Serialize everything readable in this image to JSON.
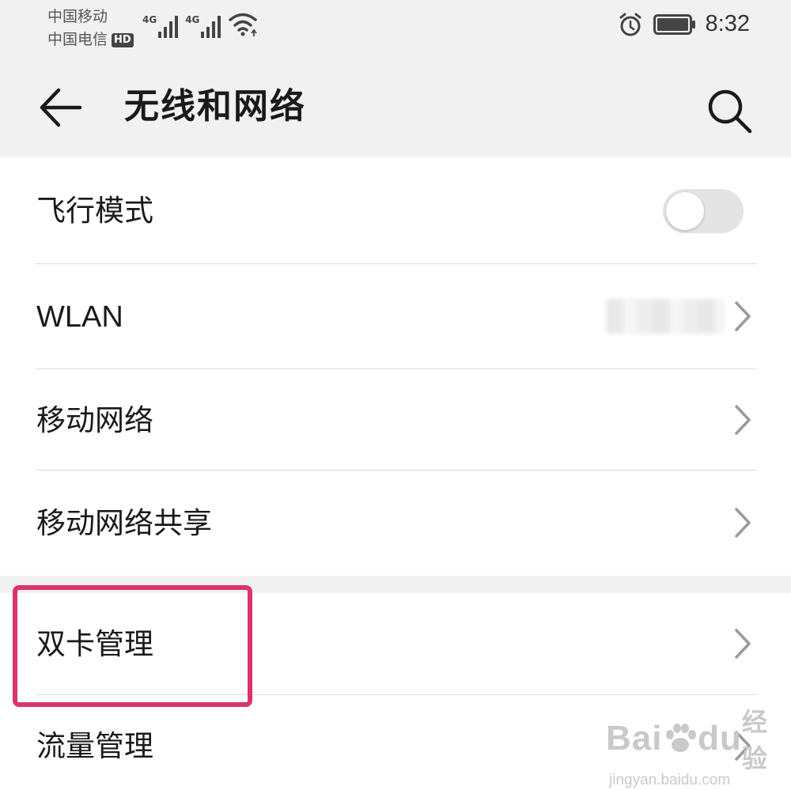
{
  "status_bar": {
    "carrier_1": "中国移动",
    "carrier_2": "中国电信",
    "hd_badge": "HD",
    "net_type_1": "4G",
    "net_type_2": "4G",
    "time": "8:32"
  },
  "app_bar": {
    "title": "无线和网络",
    "back_icon": "arrow-left-icon",
    "search_icon": "search-icon"
  },
  "settings": {
    "airplane_mode": {
      "label": "飞行模式",
      "toggle_on": false
    },
    "wlan": {
      "label": "WLAN"
    },
    "mobile_network": {
      "label": "移动网络"
    },
    "tethering": {
      "label": "移动网络共享"
    },
    "dual_sim": {
      "label": "双卡管理"
    },
    "data_usage": {
      "label": "流量管理"
    }
  },
  "watermark": {
    "brand": "Bai",
    "brand_tail": "du",
    "brand_cn": "经验",
    "url": "jingyan.baidu.com"
  },
  "colors": {
    "highlight": "#d9346d",
    "header_bg": "#f1f1f1",
    "toggle_off": "#e4e4e4"
  }
}
